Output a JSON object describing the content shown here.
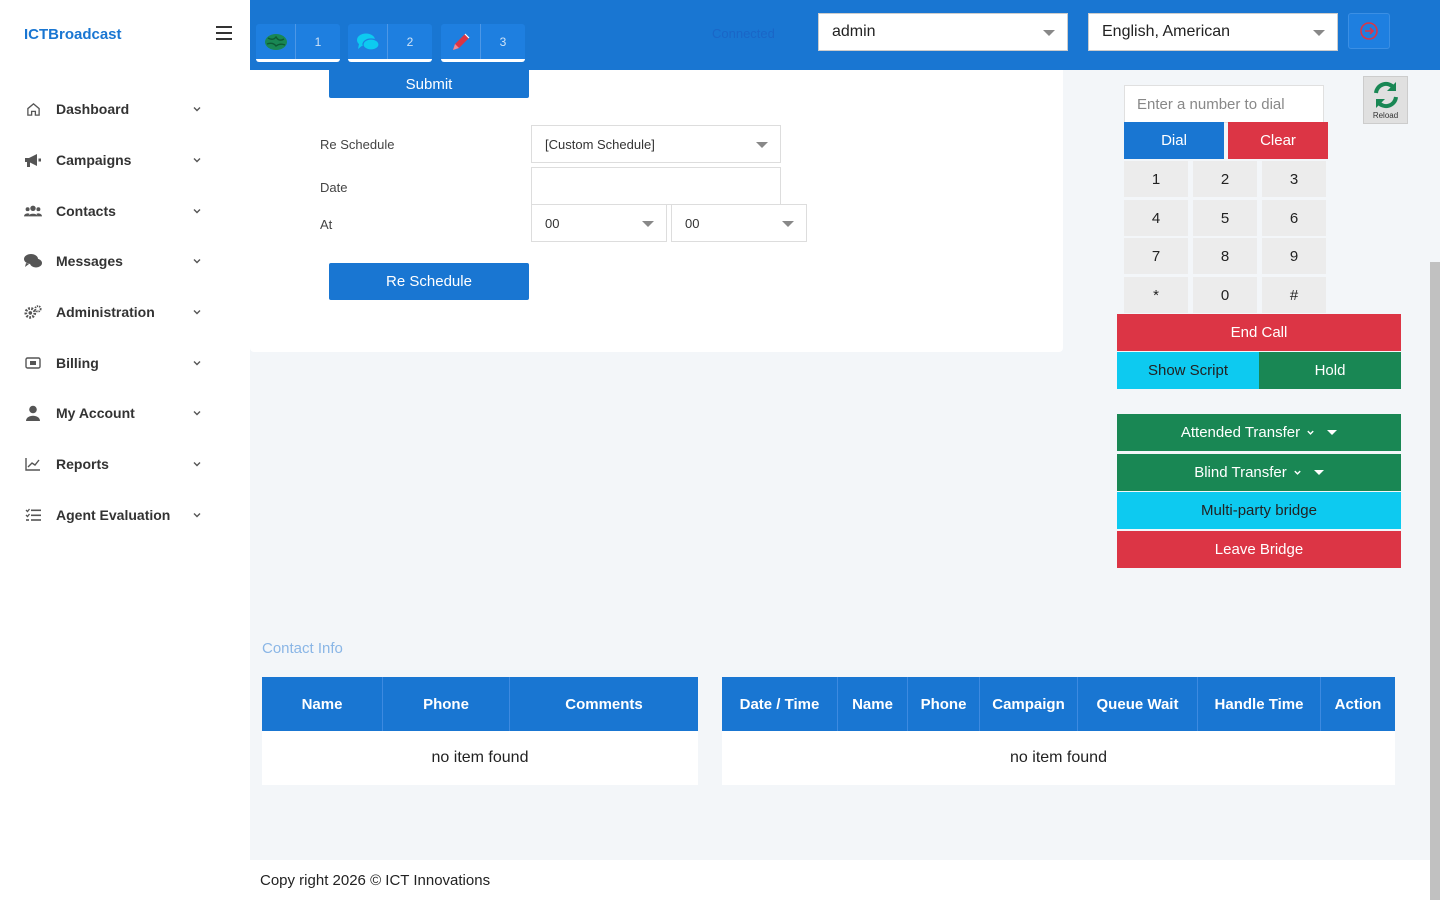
{
  "app": {
    "brand": "ICTBroadcast"
  },
  "sidebar": {
    "items": [
      {
        "label": "Dashboard",
        "icon": "home-icon"
      },
      {
        "label": "Campaigns",
        "icon": "megaphone-icon"
      },
      {
        "label": "Contacts",
        "icon": "users-icon"
      },
      {
        "label": "Messages",
        "icon": "comments-icon"
      },
      {
        "label": "Administration",
        "icon": "cogs-icon"
      },
      {
        "label": "Billing",
        "icon": "billing-icon"
      },
      {
        "label": "My Account",
        "icon": "user-icon"
      },
      {
        "label": "Reports",
        "icon": "chart-line-icon"
      },
      {
        "label": "Agent Evaluation",
        "icon": "list-check-icon"
      }
    ]
  },
  "topbar": {
    "tabs": [
      {
        "icon": "globe-icon",
        "count": "1",
        "color": "#198754"
      },
      {
        "icon": "chat-icon",
        "count": "2",
        "color": "#0dcaf0"
      },
      {
        "icon": "pen-icon",
        "count": "3",
        "color": "#dc3545"
      }
    ],
    "connection_status": "Connected",
    "user_select": "admin",
    "language_select": "English, American"
  },
  "form": {
    "submit_label": "Submit",
    "reschedule_label": "Re Schedule",
    "reschedule_value": "[Custom Schedule]",
    "date_label": "Date",
    "date_value": "",
    "at_label": "At",
    "hour_value": "00",
    "minute_value": "00",
    "reschedule_button": "Re Schedule"
  },
  "dialer": {
    "placeholder": "Enter a number to dial",
    "reload_label": "Reload",
    "dial_label": "Dial",
    "clear_label": "Clear",
    "keys": [
      "1",
      "2",
      "3",
      "4",
      "5",
      "6",
      "7",
      "8",
      "9",
      "*",
      "0",
      "#"
    ],
    "end_call": "End Call",
    "show_script": "Show Script",
    "hold": "Hold",
    "attended_transfer": "Attended Transfer",
    "blind_transfer": "Blind Transfer",
    "multi_party_bridge": "Multi-party bridge",
    "leave_bridge": "Leave Bridge"
  },
  "contact_info": {
    "title": "Contact Info",
    "columns": [
      "Name",
      "Phone",
      "Comments"
    ],
    "empty_text": "no item found"
  },
  "history": {
    "columns": [
      "Date / Time",
      "Name",
      "Phone",
      "Campaign",
      "Queue Wait",
      "Handle Time",
      "Action"
    ],
    "empty_text": "no item found"
  },
  "footer": {
    "text": "Copy right 2026 © ICT Innovations"
  }
}
